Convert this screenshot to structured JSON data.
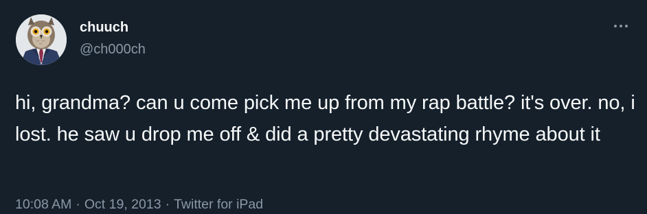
{
  "tweet": {
    "author": {
      "display_name": "chuuch",
      "handle": "@ch000ch",
      "avatar_icon": "owl-in-suit-avatar"
    },
    "more_icon": "more-options-icon",
    "text": "hi, grandma? can u come pick me up from my rap battle? it's over. no, i lost. he saw u drop me off & did a pretty devastating rhyme about it",
    "time": "10:08 AM",
    "date": "Oct 19, 2013",
    "source": "Twitter for iPad",
    "separator": "·"
  },
  "colors": {
    "background": "#15202b",
    "primary_text": "#f7f9f9",
    "secondary_text": "#8b98a5"
  }
}
